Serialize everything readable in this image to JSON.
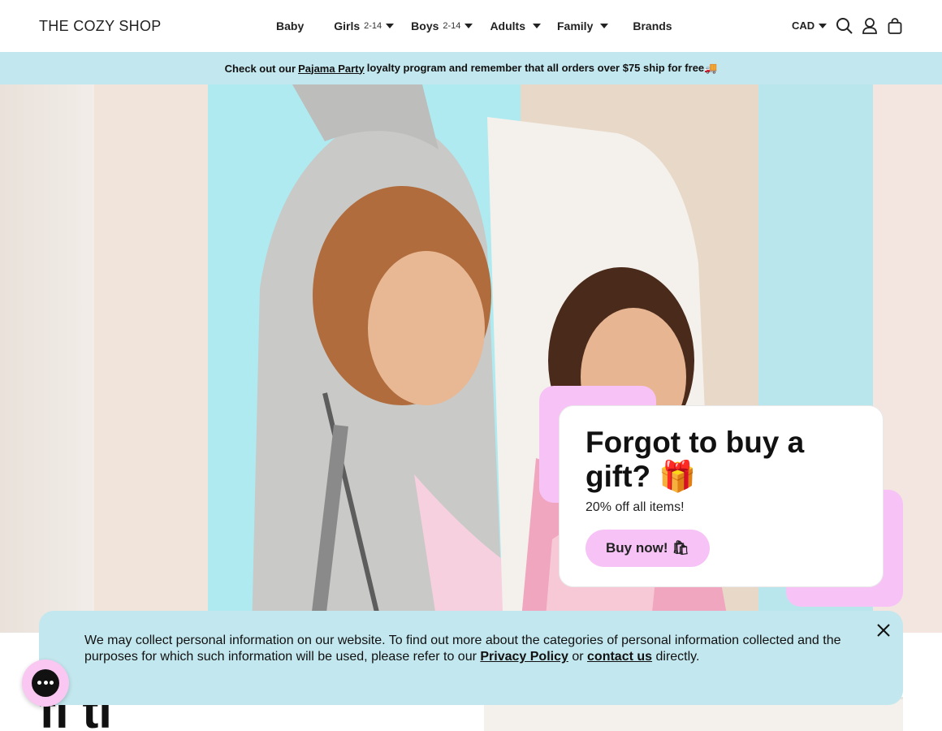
{
  "header": {
    "logo": "THE COZY SHOP",
    "nav": {
      "baby": "Baby",
      "girls": "Girls",
      "girls_sub": "2-14",
      "boys": "Boys",
      "boys_sub": "2-14",
      "adults": "Adults",
      "family": "Family",
      "brands": "Brands"
    },
    "currency": "CAD",
    "icons": [
      "search-icon",
      "account-icon",
      "cart-icon"
    ]
  },
  "announcement": {
    "prefix": "Check out our",
    "link": "Pajama Party",
    "suffix": "loyalty program and remember that all orders over $75 ship for free🚚"
  },
  "promo": {
    "title": "Forgot to buy a gift? 🎁",
    "subtitle": "20% off all items!",
    "button": "Buy now! 🛍"
  },
  "cookie": {
    "text_before": "We may collect personal information on our website. To find out more about the categories of personal information collected and the purposes for which such information will be used, please refer to our",
    "privacy_link": "Privacy Policy",
    "middle": "or",
    "contact_link": "contact us",
    "text_after": "directly."
  },
  "below": {
    "heading_partial": "fi  tl  "
  },
  "colors": {
    "announcement_bg": "#c3e7ee",
    "pink": "#f7c3f6",
    "text": "#111111"
  }
}
